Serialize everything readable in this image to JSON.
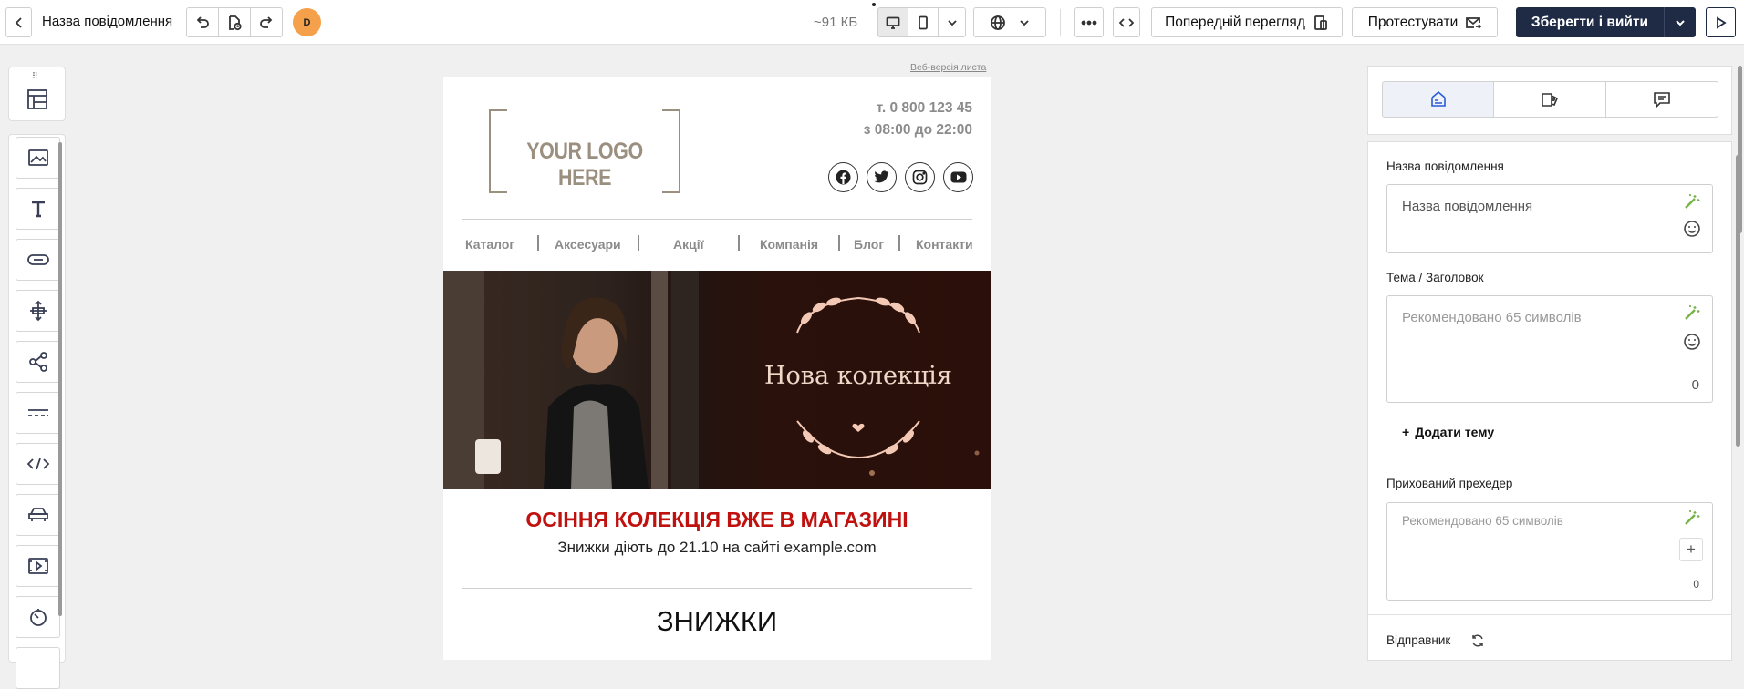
{
  "header": {
    "title": "Назва повідомлення",
    "avatar_initial": "D",
    "size": "~91 КБ",
    "preview_label": "Попередній перегляд",
    "test_label": "Протестувати",
    "save_exit_label": "Зберегти і вийти",
    "accent": "#1f2a44"
  },
  "email": {
    "web_version": "Веб-версія листа",
    "logo_text": "YOUR LOGO HERE",
    "phone": "т. 0 800 123 45",
    "hours": "з 08:00 до 22:00",
    "social": [
      "facebook-icon",
      "twitter-icon",
      "instagram-icon",
      "youtube-icon"
    ],
    "menu": [
      "Каталог",
      "Аксесуари",
      "Акції",
      "Компанія",
      "Блог",
      "Контакти"
    ],
    "hero_title": "Нова колекція",
    "headline": "ОСІННЯ КОЛЕКЦІЯ ВЖЕ В МАГАЗИНІ",
    "headline_color": "#c0110f",
    "subline": "Знижки діють до 21.10 на сайті example.com",
    "section_title": "ЗНИЖКИ"
  },
  "panel": {
    "name_label": "Назва повідомлення",
    "name_value": "Назва повідомлення",
    "subject_label": "Тема / Заголовок",
    "subject_placeholder": "Рекомендовано 65 символів",
    "subject_count": "0",
    "add_topic": "Додати тему",
    "preheader_label": "Прихований прехедер",
    "preheader_placeholder": "Рекомендовано 65 символів",
    "preheader_count": "0",
    "sender_label": "Відправник"
  }
}
